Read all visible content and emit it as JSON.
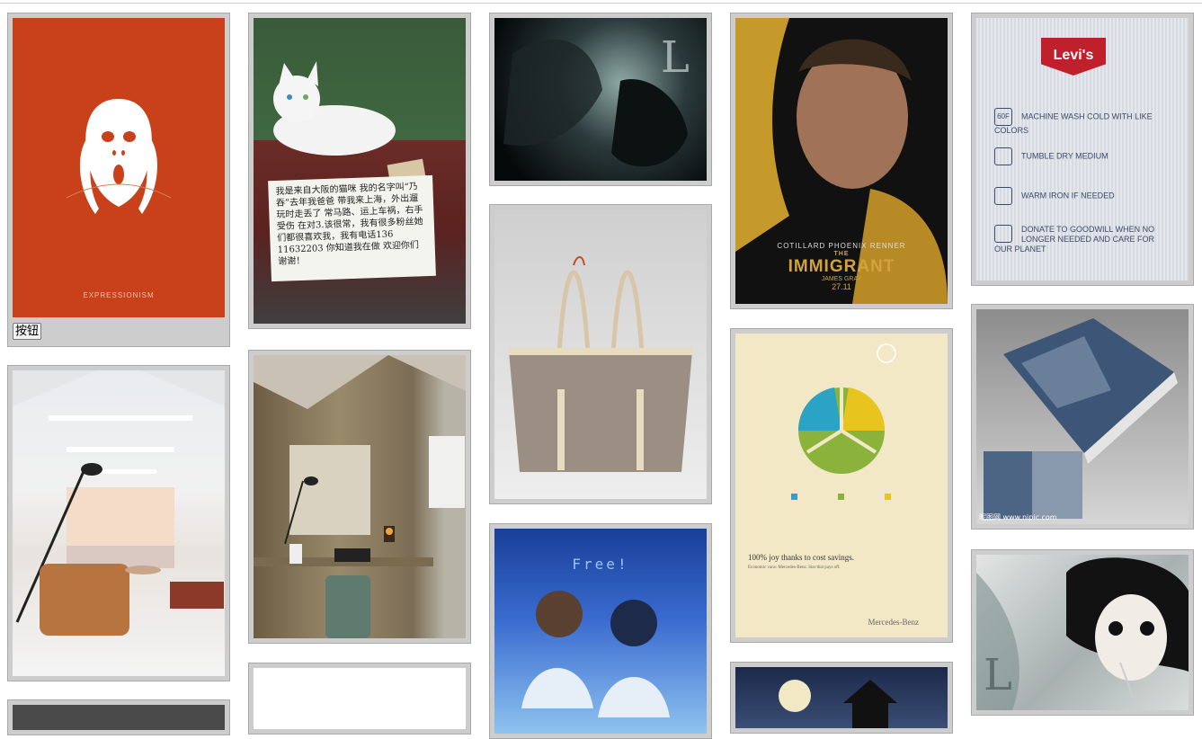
{
  "cards": {
    "expressionism": {
      "caption": "EXPRESSIONISM",
      "button_label": "按钮"
    },
    "cat": {
      "note_text": "我是来自大阪的猫咪 我的名字叫“乃吞”去年我爸爸 带我来上海，外出遛玩时走丢了 常马路、运上车祸，右手受伤 在对3.该很常，我有很多粉丝她 们都很喜欢我，我有电话136 11632203 你知道我在做 欢迎你们 谢谢！"
    },
    "immigrant": {
      "title": "IMMIGRANT",
      "title_prefix": "THE",
      "cast": "COTILLARD   PHOENIX   RENNER",
      "director": "JAMES GRAY",
      "date": "27.11"
    },
    "mercedes": {
      "headline": "100% joy thanks to cost savings.",
      "subline": "Economic vans: Mercedes-Benz. Star that pays off.",
      "brand": "Mercedes-Benz",
      "pie_colors": [
        "#2aa3c4",
        "#e8c51e",
        "#8bb33c"
      ]
    },
    "levis": {
      "logo": "Levi's",
      "rows": [
        {
          "icon": "60F",
          "text": "MACHINE WASH COLD WITH LIKE COLORS"
        },
        {
          "icon": "",
          "text": "TUMBLE DRY MEDIUM"
        },
        {
          "icon": "",
          "text": "WARM IRON IF NEEDED"
        },
        {
          "icon": "",
          "text": "DONATE TO GOODWILL WHEN NO LONGER NEEDED AND CARE FOR OUR PLANET"
        }
      ]
    },
    "brochure": {
      "watermark": "昵图网 www.nipic.com"
    },
    "free": {
      "title": "Free!"
    }
  }
}
